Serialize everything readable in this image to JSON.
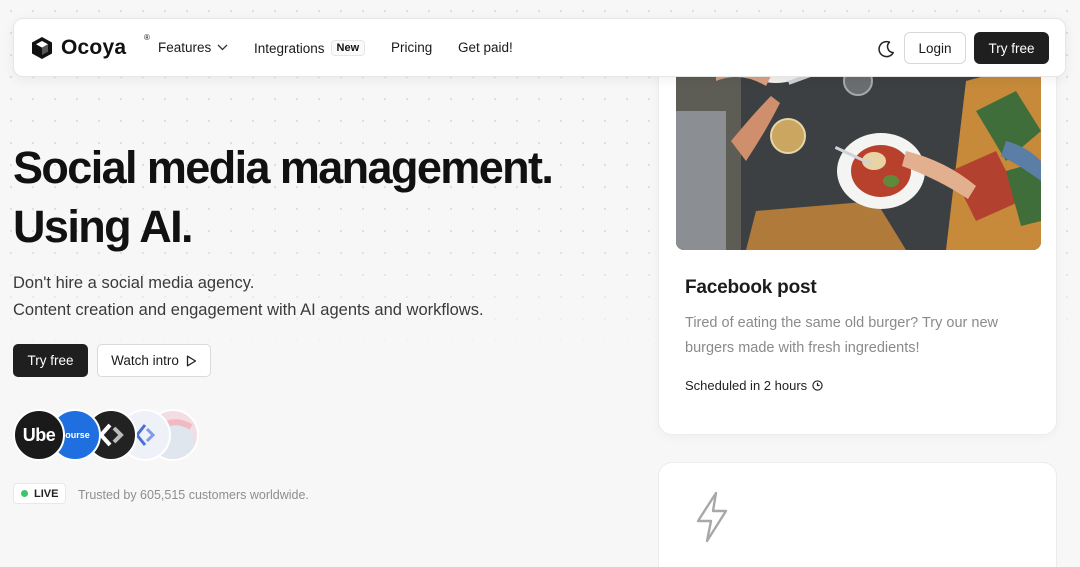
{
  "brand": {
    "name": "Ocoya",
    "registered": "®"
  },
  "nav": {
    "items": [
      {
        "label": "Features",
        "has_dropdown": true
      },
      {
        "label": "Integrations",
        "badge": "New"
      },
      {
        "label": "Pricing"
      },
      {
        "label": "Get paid!"
      }
    ],
    "theme_toggle_icon": "moon-icon",
    "login_label": "Login",
    "try_free_label": "Try free"
  },
  "hero": {
    "title_line1": "Social media management.",
    "title_line2": "Using AI.",
    "subtitle_line1": "Don't hire a social media agency.",
    "subtitle_line2": "Content creation and engagement with AI agents and workflows.",
    "try_free_label": "Try free",
    "watch_intro_label": "Watch intro"
  },
  "avatars": [
    {
      "name": "uber-logo",
      "text": "Ube",
      "bg": "#1a1a1a"
    },
    {
      "name": "coursera-logo",
      "text": "course",
      "bg": "#1f6fe0"
    },
    {
      "name": "dark-brand-logo",
      "text": "",
      "bg": "#222222"
    },
    {
      "name": "blue-brand-logo",
      "text": "",
      "bg": "#eef1f8"
    },
    {
      "name": "pink-brand-logo",
      "text": "",
      "bg": "#f3dde2"
    }
  ],
  "social_proof": {
    "live_label": "LIVE",
    "trusted_text": "Trusted by 605,515 customers worldwide."
  },
  "post_card": {
    "title": "Facebook post",
    "body": "Tired of eating the same old burger? Try our new burgers made with fresh ingredients!",
    "scheduled": "Scheduled in 2 hours",
    "image": "food-table-photo"
  },
  "colors": {
    "primary_button": "#1f1f1f",
    "live_dot": "#3bc46b",
    "muted_text": "#8a8a8a",
    "background": "#f7f7f7"
  }
}
